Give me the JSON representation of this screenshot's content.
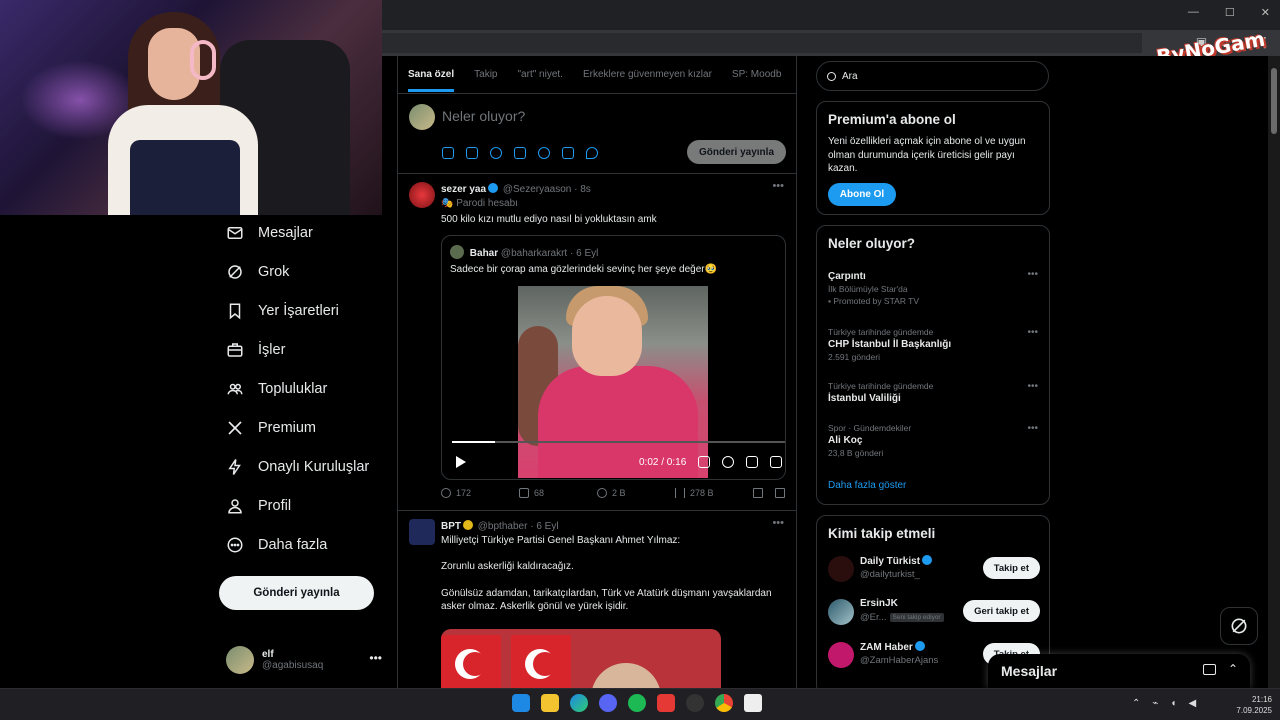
{
  "window": {
    "controls": [
      "—",
      "☐",
      "✕"
    ]
  },
  "overlay": {
    "logo_text": "ByNoGam"
  },
  "nav": {
    "items": [
      {
        "label": "Mesajlar",
        "icon": "mail-icon"
      },
      {
        "label": "Grok",
        "icon": "grok-icon"
      },
      {
        "label": "Yer İşaretleri",
        "icon": "bookmark-icon"
      },
      {
        "label": "İşler",
        "icon": "briefcase-icon"
      },
      {
        "label": "Topluluklar",
        "icon": "communities-icon"
      },
      {
        "label": "Premium",
        "icon": "x-logo-icon"
      },
      {
        "label": "Onaylı Kuruluşlar",
        "icon": "lightning-icon"
      },
      {
        "label": "Profil",
        "icon": "person-icon"
      },
      {
        "label": "Daha fazla",
        "icon": "more-circle-icon"
      }
    ],
    "post_button": "Gönderi yayınla",
    "profile": {
      "name": "elf",
      "handle": "@agabisusaq"
    }
  },
  "timeline": {
    "tabs": [
      "Sana özel",
      "Takip",
      "\"art\" niyet.",
      "Erkeklere güvenmeyen kızlar",
      "SP: Moodb"
    ],
    "composer": {
      "placeholder": "Neler oluyor?",
      "send": "Gönderi yayınla"
    },
    "tweet1": {
      "name": "sezer yaa",
      "handle": "@Sezeryaason",
      "time": "8s",
      "label": "Parodi hesabı",
      "text": "500 kilo kızı mutlu ediyo nasıl bi yokluktasın amk",
      "quote": {
        "name": "Bahar",
        "handle": "@baharkarakrt",
        "time": "6 Eyl",
        "text": "Sadece bir çorap ama gözlerindeki sevinç her şeye değer🥹",
        "video_time": "0:02 / 0:16",
        "progress": 0.13
      },
      "stats": {
        "replies": "172",
        "reposts": "68",
        "likes": "2 B",
        "views": "278 B"
      }
    },
    "tweet2": {
      "name": "BPT",
      "handle": "@bpthaber",
      "time": "6 Eyl",
      "line1": "Milliyetçi Türkiye Partisi Genel Başkanı Ahmet Yılmaz:",
      "line2": "Zorunlu askerliği kaldıracağız.",
      "line3": "Gönülsüz adamdan, tarikatçılardan, Türk ve Atatürk düşmanı yavşaklardan",
      "line4": "asker olmaz. Askerlik gönül ve yürek işidir."
    }
  },
  "right": {
    "search_placeholder": "Ara",
    "premium": {
      "title": "Premium'a abone ol",
      "text": "Yeni özellikleri açmak için abone ol ve uygun olman durumunda içerik üreticisi gelir payı kazan.",
      "button": "Abone Ol"
    },
    "trends": {
      "title": "Neler oluyor?",
      "items": [
        {
          "category": "",
          "name": "Çarpıntı",
          "count": "İlk Bölümüyle Star'da",
          "extra": "Promoted by STAR TV"
        },
        {
          "category": "Türkiye tarihinde gündemde",
          "name": "CHP İstanbul İl Başkanlığı",
          "count": "2.591 gönderi"
        },
        {
          "category": "Türkiye tarihinde gündemde",
          "name": "İstanbul Valiliği",
          "count": ""
        },
        {
          "category": "Spor · Gündemdekiler",
          "name": "Ali Koç",
          "count": "23,8 B gönderi"
        }
      ],
      "show_more": "Daha fazla göster"
    },
    "who_to_follow": {
      "title": "Kimi takip etmeli",
      "items": [
        {
          "name": "Daily Türkist",
          "handle": "@dailyturkist_",
          "button": "Takip et",
          "follows_you": ""
        },
        {
          "name": "ErsinJK",
          "handle": "@Er...",
          "button": "Geri takip et",
          "follows_you": "Seni takip ediyor"
        },
        {
          "name": "ZAM Haber",
          "handle": "@ZamHaberAjans",
          "button": "Takip et",
          "follows_you": ""
        }
      ]
    },
    "messages_drawer": "Mesajlar"
  },
  "taskbar": {
    "time": "21:16",
    "date": "7.09.2025"
  },
  "colors": {
    "accent": "#1d9bf0",
    "background": "#000000",
    "border": "#2f3336",
    "muted": "#71767b"
  }
}
